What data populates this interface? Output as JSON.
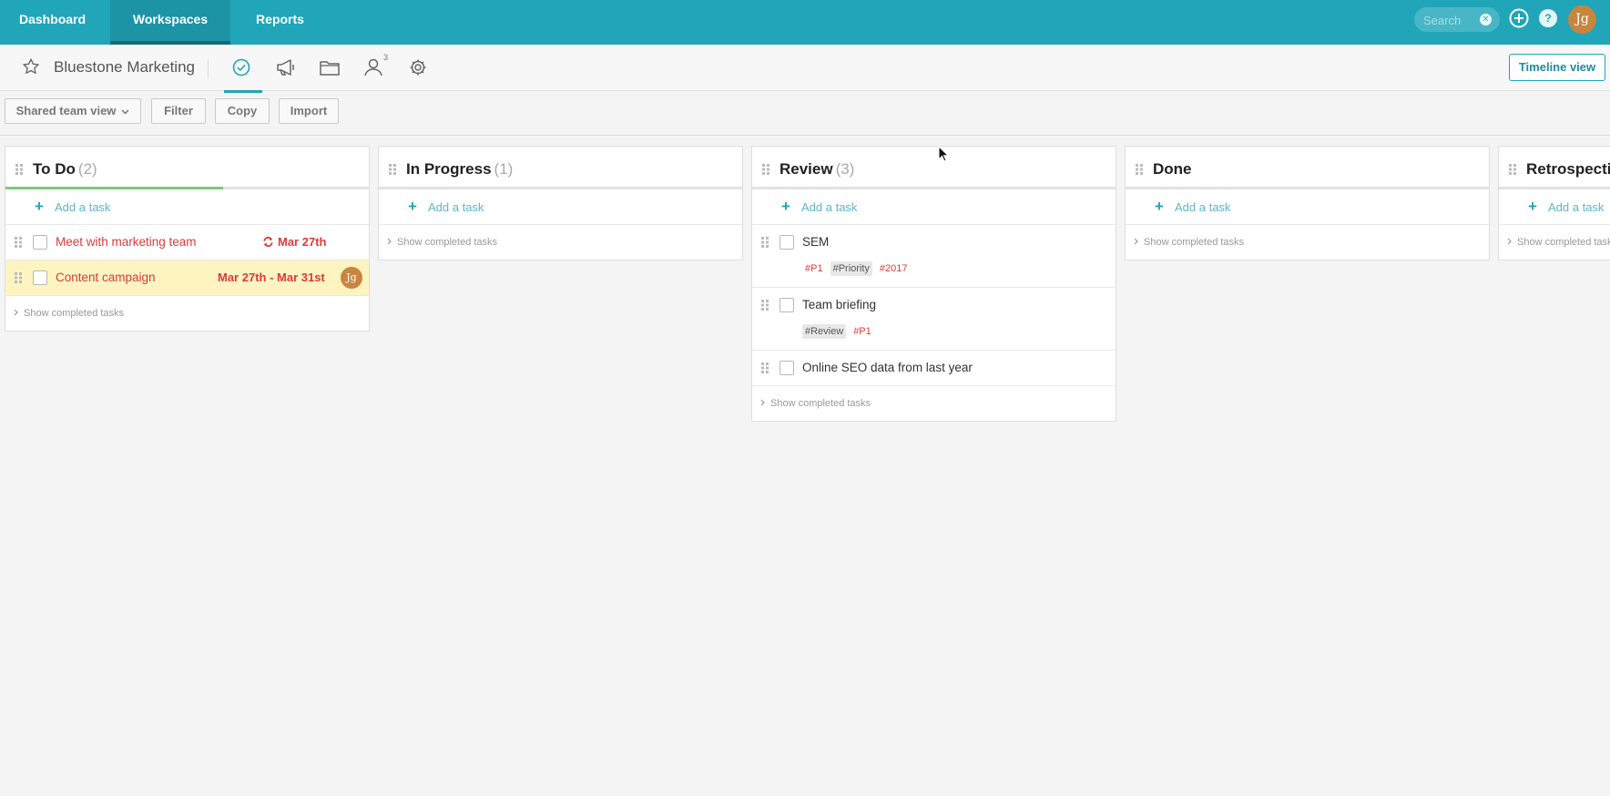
{
  "nav": {
    "tabs": [
      {
        "label": "Dashboard"
      },
      {
        "label": "Workspaces"
      },
      {
        "label": "Reports"
      }
    ],
    "search_placeholder": "Search",
    "user_initials": "Jg"
  },
  "subheader": {
    "workspace_title": "Bluestone Marketing",
    "people_count": "3",
    "timeline_button": "Timeline view"
  },
  "toolbar": {
    "view_select": "Shared team view",
    "filter": "Filter",
    "copy": "Copy",
    "import": "Import"
  },
  "board": {
    "add_task_label": "Add a task",
    "show_completed_label": "Show completed tasks",
    "columns": [
      {
        "title": "To Do",
        "count": "(2)",
        "progress": 0.6,
        "tasks": [
          {
            "title": "Meet with marketing team",
            "date": "Mar 27th",
            "recurring": true
          },
          {
            "title": "Content campaign",
            "date": "Mar 27th - Mar 31st",
            "assignee": "Jg"
          }
        ]
      },
      {
        "title": "In Progress",
        "count": "(1)",
        "tasks": []
      },
      {
        "title": "Review",
        "count": "(3)",
        "tasks": [
          {
            "title": "SEM",
            "tags": [
              "#P1",
              "#Priority",
              "#2017"
            ]
          },
          {
            "title": "Team briefing",
            "tags": [
              "#Review",
              "#P1"
            ]
          },
          {
            "title": "Online SEO data from last year"
          }
        ]
      },
      {
        "title": "Done",
        "count": "",
        "tasks": []
      },
      {
        "title": "Retrospectiv",
        "count": "",
        "tasks": []
      }
    ]
  },
  "colors": {
    "brand": "#21a5b9",
    "overdue": "#dc3a3a",
    "progress": "#7bc97b",
    "highlight": "#fdf4c0"
  }
}
